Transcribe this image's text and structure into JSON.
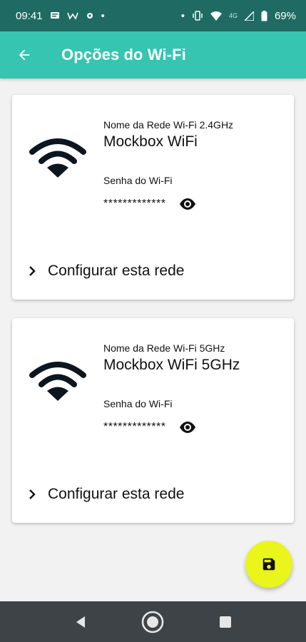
{
  "status_bar": {
    "time": "09:41",
    "battery": "69%",
    "network": "4G",
    "dot": "•"
  },
  "app_bar": {
    "title": "Opções do Wi-Fi"
  },
  "networks": [
    {
      "ssid_label": "Nome da Rede Wi-Fi 2.4GHz",
      "ssid": "Mockbox WiFi",
      "password_label": "Senha do Wi-Fi",
      "password": "*************",
      "configure_label": "Configurar esta rede"
    },
    {
      "ssid_label": "Nome da Rede Wi-Fi 5GHz",
      "ssid": "Mockbox WiFi 5GHz",
      "password_label": "Senha do Wi-Fi",
      "password": "*************",
      "configure_label": "Configurar esta rede"
    }
  ],
  "icons": {
    "back": "arrow-back-icon",
    "wifi": "wifi-icon",
    "visibility": "eye-icon",
    "chevron": "chevron-right-icon",
    "save": "floppy-disk-icon",
    "nav_back": "triangle-back-icon",
    "nav_home": "circle-home-icon",
    "nav_recent": "square-recents-icon"
  },
  "colors": {
    "app_bar": "#35c5b1",
    "status_bar": "#1f6b63",
    "fab": "#eaf51b",
    "nav_bar": "#3e4347",
    "background": "#f2f2f2"
  }
}
